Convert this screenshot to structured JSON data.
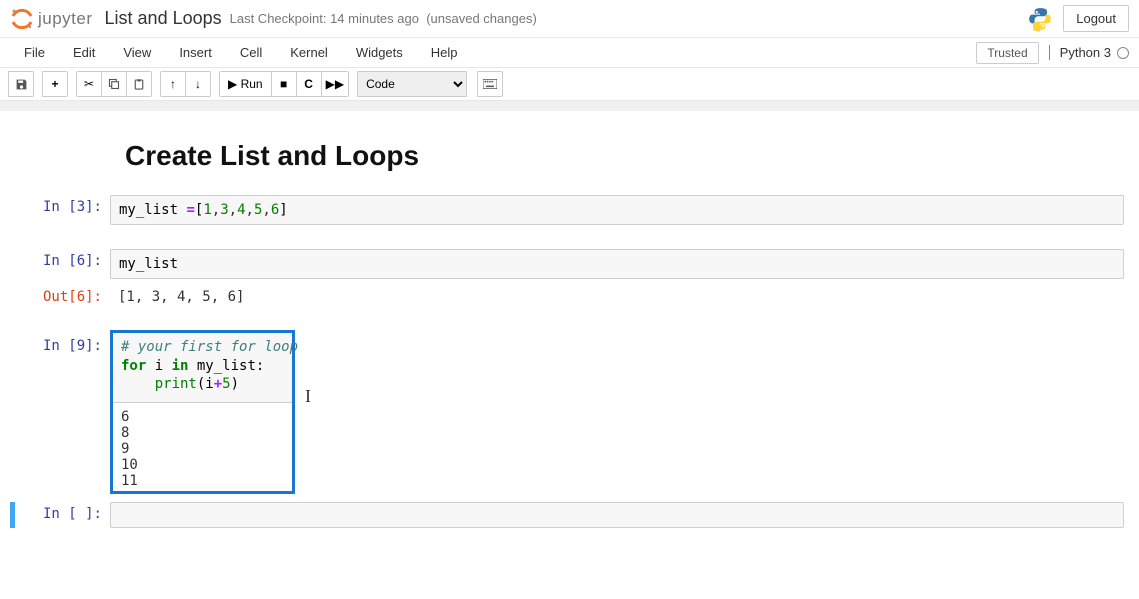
{
  "header": {
    "logo_text": "jupyter",
    "title": "List and Loops",
    "checkpoint": "Last Checkpoint: 14 minutes ago",
    "unsaved": "(unsaved changes)",
    "logout": "Logout"
  },
  "menubar": {
    "items": [
      "File",
      "Edit",
      "View",
      "Insert",
      "Cell",
      "Kernel",
      "Widgets",
      "Help"
    ],
    "trusted": "Trusted",
    "kernel": "Python 3"
  },
  "toolbar": {
    "run_label": "Run",
    "cell_type": "Code"
  },
  "cells": {
    "markdown_h1": "Create List and Loops",
    "c1": {
      "prompt": "In [3]:",
      "code_pre": "my_list ",
      "code_op": "=",
      "code_vals": "[1,3,4,5,6]"
    },
    "c2": {
      "in_prompt": "In [6]:",
      "code": "my_list",
      "out_prompt": "Out[6]:",
      "output": "[1, 3, 4, 5, 6]"
    },
    "c3": {
      "prompt": "In [9]:",
      "comment": "# your first for loop",
      "kw_for": "for",
      "var_i": " i ",
      "kw_in": "in",
      "var_ml": " my_list:",
      "builtin_print": "print",
      "args": "(i",
      "op_plus": "+",
      "num5": "5",
      "close": ")",
      "output": "6\n8\n9\n10\n11"
    },
    "c4": {
      "prompt": "In [ ]:"
    }
  }
}
